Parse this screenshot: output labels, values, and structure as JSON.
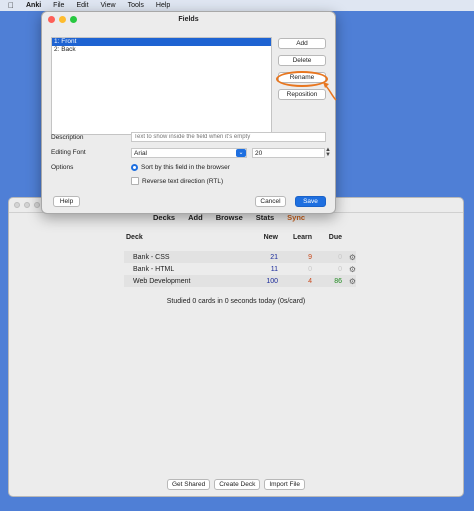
{
  "menubar": {
    "apple_icon": "apple-icon",
    "items": [
      "Anki",
      "File",
      "Edit",
      "View",
      "Tools",
      "Help"
    ]
  },
  "dialog": {
    "title": "Fields",
    "fields": [
      "1: Front",
      "2: Back"
    ],
    "buttons": {
      "add": "Add",
      "delete": "Delete",
      "rename": "Rename",
      "reposition": "Reposition"
    },
    "description_label": "Description",
    "description_placeholder": "Text to show inside the field when it's empty",
    "editing_font_label": "Editing Font",
    "font_value": "Arial",
    "font_size_value": "20",
    "options_label": "Options",
    "option_sort": "Sort by this field in the browser",
    "option_rtl": "Reverse text direction (RTL)",
    "help": "Help",
    "cancel": "Cancel",
    "save": "Save",
    "annotation_color": "#e8761f"
  },
  "main": {
    "toolbar": [
      "Decks",
      "Add",
      "Browse",
      "Stats",
      "Sync"
    ],
    "columns": {
      "deck": "Deck",
      "new": "New",
      "learn": "Learn",
      "due": "Due"
    },
    "decks": [
      {
        "name": "Bank - CSS",
        "new": "21",
        "learn": "9",
        "due": "0"
      },
      {
        "name": "Bank - HTML",
        "new": "11",
        "learn": "0",
        "due": "0"
      },
      {
        "name": "Web Development",
        "new": "100",
        "learn": "4",
        "due": "86"
      }
    ],
    "studied": "Studied 0 cards in 0 seconds today (0s/card)",
    "bottom_buttons": [
      "Get Shared",
      "Create Deck",
      "Import File"
    ]
  },
  "colors": {
    "new": "#1a2a9a",
    "learn": "#c9481a",
    "due": "#1f8a1f",
    "sync": "#c85f1a",
    "accent": "#1e6fe0"
  }
}
